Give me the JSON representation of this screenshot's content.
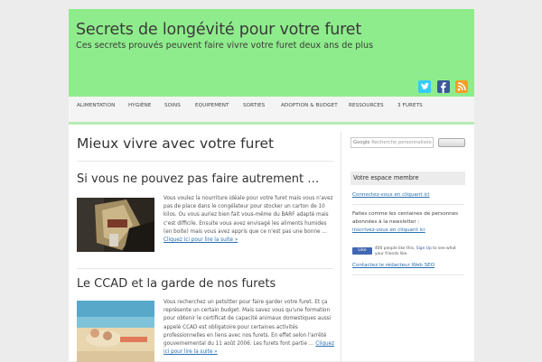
{
  "header": {
    "title": "Secrets de longévité pour votre furet",
    "tagline": "Ces secrets prouvés peuvent faire vivre votre furet deux ans de plus",
    "social": [
      "twitter-icon",
      "facebook-icon",
      "rss-icon"
    ],
    "colors": {
      "header_bg": "#8fec8c",
      "link": "#2a6fb0"
    }
  },
  "nav": {
    "items": [
      "ALIMENTATION",
      "HYGIÈNE",
      "SOINS",
      "EQUIPEMENT",
      "SORTIES",
      "ADOPTION & BUDGET",
      "RESSOURCES",
      "3 FURETS"
    ]
  },
  "content": {
    "page_title": "Mieux vivre avec votre furet",
    "posts": [
      {
        "title": "Si vous ne pouvez pas faire autrement …",
        "excerpt": "Vous voulez la nourriture idéale pour votre furet mais vous n'avez pas de place dans le congélateur pour stocker un carton de 10 kilos. Ou vous auriez bien fait vous-même du BARF adapté mais c'est difficile. Ensuite vous avez envisagé les aliments humides (en boite) mais vous avez appris que ce n'est pas une bonne … ",
        "more": "Cliquez ici pour lire la suite »"
      },
      {
        "title": "Le CCAD et la garde de nos furets",
        "excerpt": "Vous recherchez un petsitter pour faire garder votre furet. Et ça représente un certain budget. Mais savez vous qu'une formation pour obtenir le certificat de capacité animaux domestiques aussi appelé CCAD est obligatoire pour certaines activités professionnelles en liens avec nos furets. En effet selon l'arrêté gouvernemental du 11 août 2006. Les furets font partie … ",
        "more": "Cliquez ici pour lire la suite »"
      }
    ]
  },
  "sidebar": {
    "search_label": "Google",
    "search_placeholder": "Recherche personnalisée",
    "widget_title": "Votre espace membre",
    "login_link": "Connectez-vous en cliquant ici",
    "newsletter_text": "Faites comme les centaines de personnes abonnées à la newsletter : ",
    "newsletter_link": "inscrivez-vous en cliquant ici",
    "like_label": "Like",
    "like_text": "400 people like this. ",
    "like_signup": "Sign Up",
    "like_text2": " to see what your friends like.",
    "contact_link": "Contactez le rédacteur Web SEO"
  }
}
